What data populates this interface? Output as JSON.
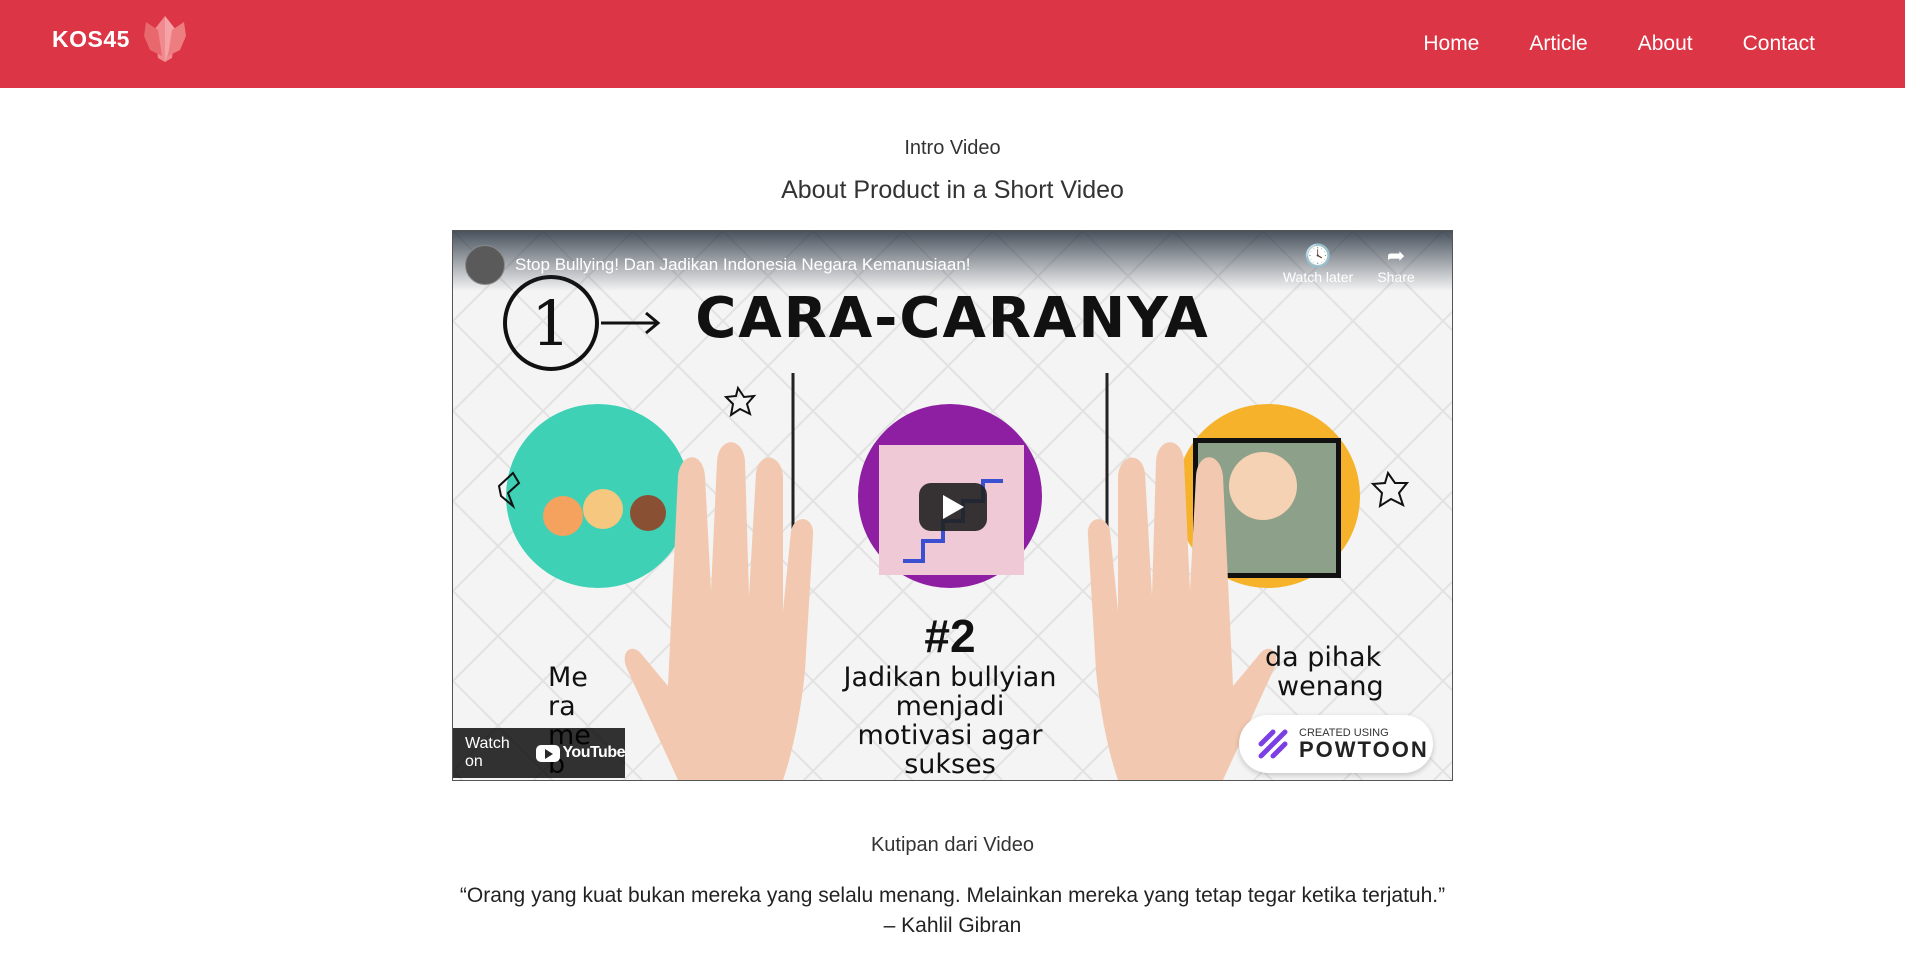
{
  "navbar": {
    "brand": "KOS45",
    "links": [
      "Home",
      "Article",
      "About",
      "Contact"
    ],
    "bg_color": "#dc3545"
  },
  "intro": {
    "subtitle": "Intro Video",
    "title": "About Product in a Short Video"
  },
  "video": {
    "title": "Stop Bullying! Dan Jadikan Indonesia Negara Kemanusiaan!",
    "watch_later": "Watch later",
    "share": "Share",
    "watch_on": "Watch on",
    "youtube": "YouTube",
    "scene": {
      "number": "1",
      "heading": "CARA-CARANYA",
      "center_num": "#2",
      "center_text": [
        "Jadikan bullyian",
        "menjadi",
        "motivasi agar",
        "sukses"
      ],
      "left_text": [
        "Me",
        "ra",
        "me",
        "b"
      ],
      "right_text": [
        "da pihak",
        "wenang"
      ],
      "powtoon_small": "CREATED USING",
      "powtoon_big": "POWTOON"
    }
  },
  "quote_section": {
    "subtitle": "Kutipan dari Video",
    "quote": "“Orang yang kuat bukan mereka yang selalu menang. Melainkan mereka yang tetap tegar ketika terjatuh.”",
    "author": "– Kahlil Gibran"
  }
}
